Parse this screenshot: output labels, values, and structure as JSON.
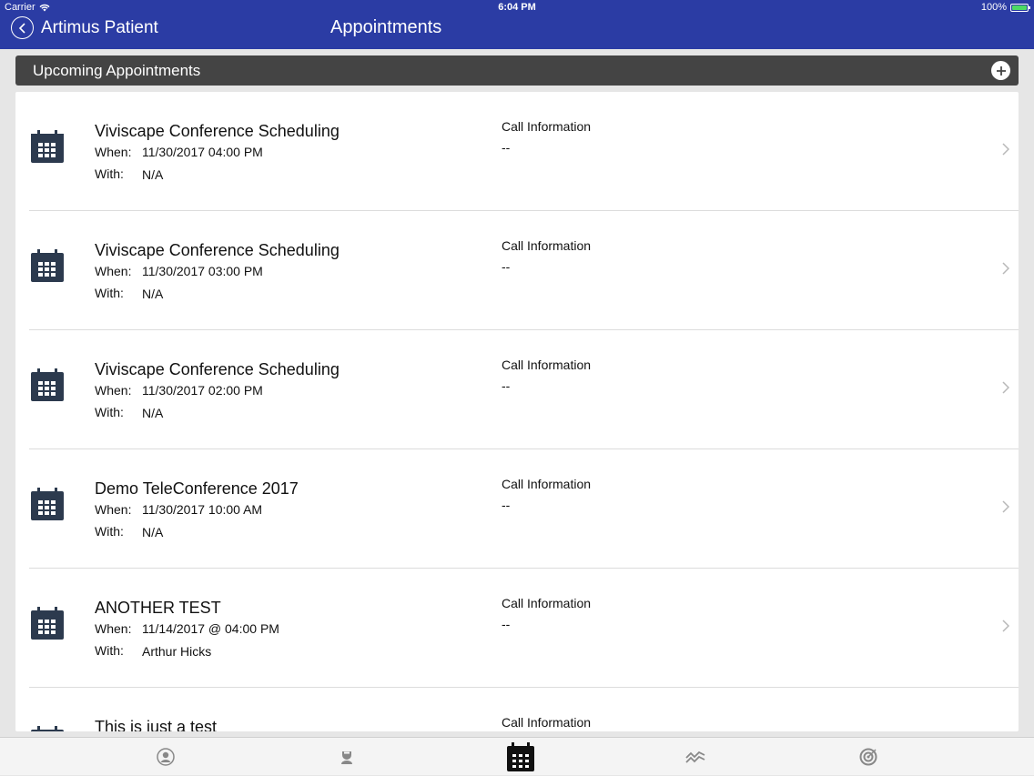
{
  "status": {
    "carrier": "Carrier",
    "time": "6:04 PM",
    "battery": "100%"
  },
  "nav": {
    "back_label": "Artimus Patient",
    "title": "Appointments"
  },
  "section": {
    "title": "Upcoming Appointments"
  },
  "call_info_label": "Call Information",
  "appointments": [
    {
      "title": "Viviscape Conference Scheduling",
      "when_label": "When:",
      "when": "11/30/2017 04:00 PM",
      "with_label": "With:",
      "with": "N/A",
      "call_info": "--"
    },
    {
      "title": "Viviscape Conference Scheduling",
      "when_label": "When:",
      "when": "11/30/2017 03:00 PM",
      "with_label": "With:",
      "with": "N/A",
      "call_info": "--"
    },
    {
      "title": "Viviscape Conference Scheduling",
      "when_label": "When:",
      "when": "11/30/2017 02:00 PM",
      "with_label": "With:",
      "with": "N/A",
      "call_info": "--"
    },
    {
      "title": "Demo TeleConference 2017",
      "when_label": "When:",
      "when": "11/30/2017 10:00 AM",
      "with_label": "With:",
      "with": "N/A",
      "call_info": "--"
    },
    {
      "title": "ANOTHER TEST",
      "when_label": "When:",
      "when": "11/14/2017 @ 04:00 PM",
      "with_label": "With:",
      "with": "Arthur Hicks",
      "call_info": "--"
    },
    {
      "title": "This is just a test",
      "when_label": "",
      "when": "",
      "with_label": "",
      "with": "",
      "call_info": ""
    }
  ],
  "tabs": [
    {
      "icon": "profile-icon",
      "active": false
    },
    {
      "icon": "doctor-icon",
      "active": false
    },
    {
      "icon": "calendar-icon",
      "active": true
    },
    {
      "icon": "vitals-chart-icon",
      "active": false
    },
    {
      "icon": "target-icon",
      "active": false
    }
  ],
  "colors": {
    "brand": "#2b3ca4",
    "section_bar": "#444444",
    "calendar_icon": "#2c3a4e"
  }
}
